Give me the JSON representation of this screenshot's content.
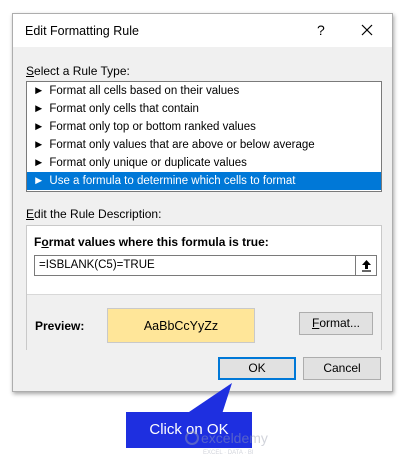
{
  "dialog": {
    "title": "Edit Formatting Rule",
    "help_glyph": "?",
    "select_rule_type": {
      "pre": "",
      "accel": "S",
      "post": "elect a Rule Type:"
    },
    "rule_types": [
      "Format all cells based on their values",
      "Format only cells that contain",
      "Format only top or bottom ranked values",
      "Format only values that are above or below average",
      "Format only unique or duplicate values",
      "Use a formula to determine which cells to format"
    ],
    "selected_rule_index": 5,
    "edit_description": {
      "pre": "",
      "accel": "E",
      "post": "dit the Rule Description:"
    },
    "formula_label": {
      "pre": "F",
      "accel": "o",
      "post": "rmat values where this formula is true:"
    },
    "formula_value": "=ISBLANK(C5)=TRUE",
    "preview_label": "Preview:",
    "preview_sample": "AaBbCcYyZz",
    "format_button": {
      "pre": "",
      "accel": "F",
      "post": "ormat..."
    },
    "ok_label": "OK",
    "cancel_label": "Cancel"
  },
  "callout": {
    "text": "Click on OK"
  },
  "watermark": {
    "brand": "exceldemy",
    "tagline": "EXCEL · DATA · BI"
  },
  "colors": {
    "selection": "#0078d7",
    "preview_fill": "#ffe699",
    "callout_fill": "#1e2fe0"
  }
}
